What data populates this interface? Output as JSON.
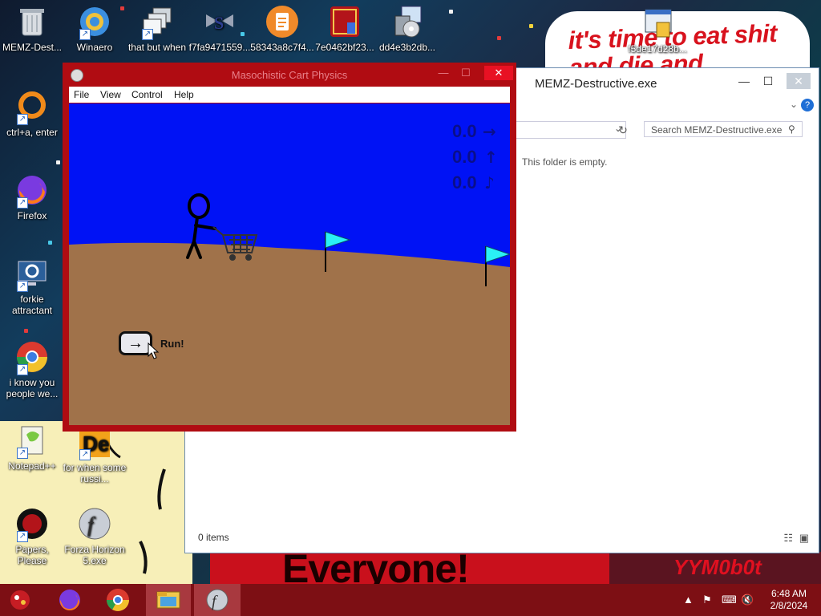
{
  "desktop": {
    "icons": [
      {
        "label": "MEMZ-Dest..."
      },
      {
        "label": "Winaero"
      },
      {
        "label": "that but when"
      },
      {
        "label": "f7fa9471559..."
      },
      {
        "label": "58343a8c7f4..."
      },
      {
        "label": "7e0462bf23..."
      },
      {
        "label": "dd4e3b2db..."
      },
      {
        "label": "f5de17d28b..."
      },
      {
        "label": "ctrl+a, enter"
      },
      {
        "label": "Firefox"
      },
      {
        "label": "forkie attractant"
      },
      {
        "label": "i know you people we..."
      },
      {
        "label": "Notepad++"
      },
      {
        "label": "for when some russi..."
      },
      {
        "label": "Papers, Please"
      },
      {
        "label": "Forza Horizon 5.exe"
      }
    ],
    "poster_top_text": "it's time to eat shit and die and celebrate",
    "poster_bottom_text": "Everyone!",
    "poster_right_text": "YYM0b0t"
  },
  "explorer": {
    "title": "MEMZ-Destructive.exe",
    "search_placeholder": "Search MEMZ-Destructive.exe",
    "empty_message": "This folder is empty.",
    "item_count": "0 items"
  },
  "game": {
    "window_title": "Masochistic Cart Physics",
    "menu": [
      "File",
      "View",
      "Control",
      "Help"
    ],
    "readouts": [
      {
        "value": "0.0",
        "arrow": "→"
      },
      {
        "value": "0.0",
        "arrow": "↑"
      },
      {
        "value": "0.0",
        "arrow": "♪"
      }
    ],
    "run_button_arrow": "→",
    "run_label": "Run!",
    "colors": {
      "sky": "#0012f5",
      "ground": "#a0724a",
      "flag": "#2af0f5"
    }
  },
  "taskbar": {
    "time": "6:48 AM",
    "date": "2/8/2024"
  }
}
